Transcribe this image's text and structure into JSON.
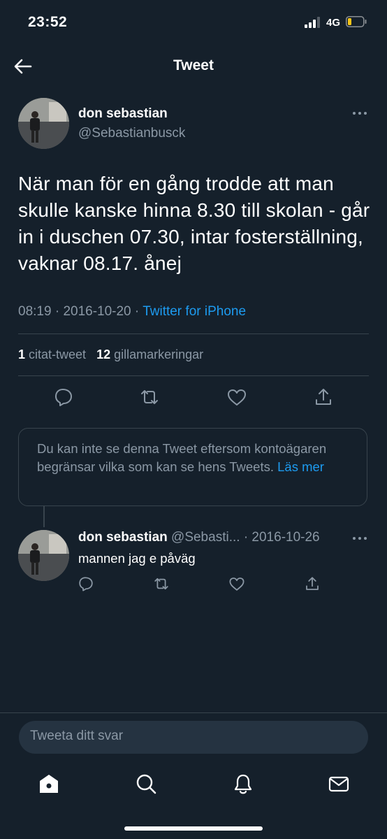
{
  "status_bar": {
    "time": "23:52",
    "network": "4G"
  },
  "nav": {
    "title": "Tweet"
  },
  "tweet": {
    "author_name": "don sebastian",
    "author_handle": "@Sebastianbusck",
    "text": "När man för en gång trodde att man skulle kanske hinna 8.30 till skolan - går in i duschen 07.30, intar fosterställning, vaknar 08.17. ånej",
    "time": "08:19",
    "date": "2016-10-20",
    "source": "Twitter for iPhone",
    "quote_count": "1",
    "quote_label": "citat-tweet",
    "like_count": "12",
    "like_label": "gillamarkeringar"
  },
  "notice": {
    "text": "Du kan inte se denna Tweet eftersom kontoägaren begränsar vilka som kan se hens Tweets.",
    "link": "Läs mer"
  },
  "reply": {
    "author_name": "don sebastian",
    "author_handle": "@Sebasti...",
    "date": "2016-10-26",
    "text": "mannen jag e påväg"
  },
  "composer": {
    "placeholder": "Tweeta ditt svar"
  },
  "icons": {
    "back": "arrow-left-icon",
    "more": "more-horizontal-icon",
    "reply": "reply-icon",
    "retweet": "retweet-icon",
    "like": "heart-icon",
    "share": "share-icon",
    "home": "home-icon",
    "search": "search-icon",
    "notifications": "bell-icon",
    "messages": "mail-icon"
  },
  "colors": {
    "background": "#15202b",
    "accent": "#1d9bf0",
    "secondary_text": "#8b98a5",
    "battery": "#f5c518"
  }
}
